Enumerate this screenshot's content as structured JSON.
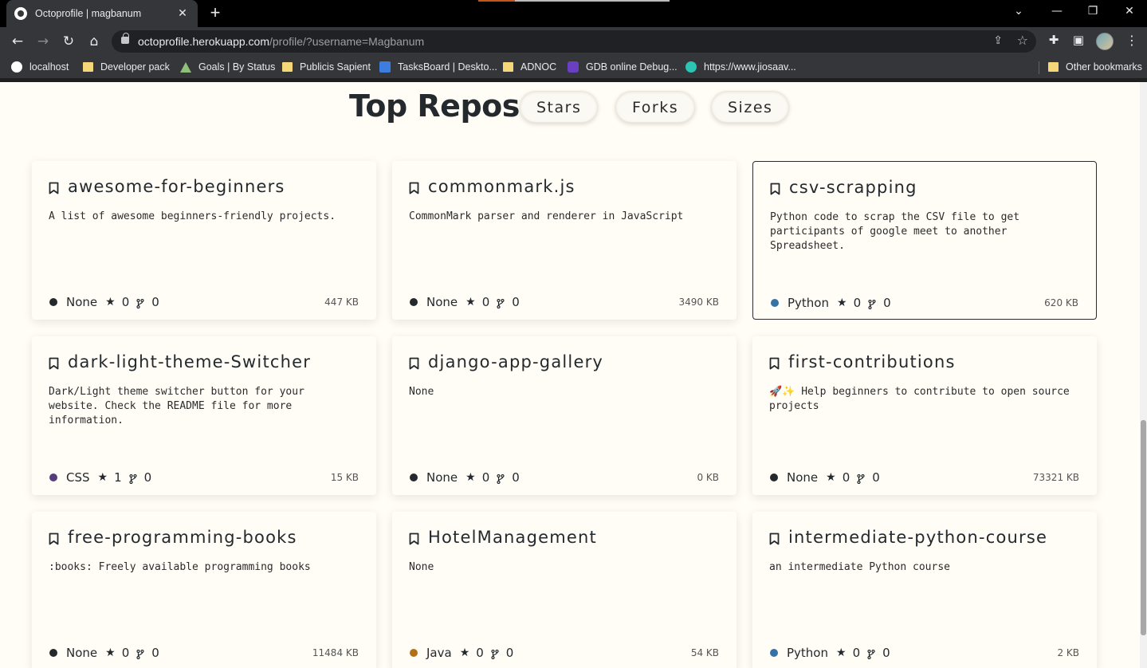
{
  "browser": {
    "tab_title": "Octoprofile | magbanum",
    "tab_close": "✕",
    "new_tab": "+",
    "url_host": "octoprofile.herokuapp.com",
    "url_path": "/profile/?username=Magbanum",
    "bookmarks": [
      {
        "label": "localhost",
        "icon": "github-icon"
      },
      {
        "label": "Developer pack",
        "icon": "folder-icon"
      },
      {
        "label": "Goals | By Status",
        "icon": "triangle-icon"
      },
      {
        "label": "Publicis Sapient",
        "icon": "folder-icon"
      },
      {
        "label": "TasksBoard | Deskto...",
        "icon": "tasksboard-icon"
      },
      {
        "label": "ADNOC",
        "icon": "folder-icon"
      },
      {
        "label": "GDB online Debug...",
        "icon": "gdb-icon"
      },
      {
        "label": "https://www.jiosaav...",
        "icon": "jiosaavn-icon"
      }
    ],
    "other_bookmarks": "Other bookmarks"
  },
  "page": {
    "heading": "Top Repos",
    "sort_buttons": [
      "Stars",
      "Forks",
      "Sizes"
    ]
  },
  "repos": [
    {
      "name": "awesome-for-beginners",
      "description": "A list of awesome beginners-friendly projects.",
      "language": "None",
      "lang_color": "#24292e",
      "stars": "0",
      "forks": "0",
      "size": "447 KB"
    },
    {
      "name": "commonmark.js",
      "description": "CommonMark parser and renderer in JavaScript",
      "language": "None",
      "lang_color": "#24292e",
      "stars": "0",
      "forks": "0",
      "size": "3490 KB"
    },
    {
      "name": "csv-scrapping",
      "description": "Python code to scrap the CSV file to get participants of google meet to another Spreadsheet.",
      "language": "Python",
      "lang_color": "#3572a5",
      "stars": "0",
      "forks": "0",
      "size": "620 KB"
    },
    {
      "name": "dark-light-theme-Switcher",
      "description": "Dark/Light theme switcher button for your website. Check the README file for more information.",
      "language": "CSS",
      "lang_color": "#563d7c",
      "stars": "1",
      "forks": "0",
      "size": "15 KB"
    },
    {
      "name": "django-app-gallery",
      "description": "None",
      "language": "None",
      "lang_color": "#24292e",
      "stars": "0",
      "forks": "0",
      "size": "0 KB"
    },
    {
      "name": "first-contributions",
      "description": "🚀✨ Help beginners to contribute to open source projects",
      "language": "None",
      "lang_color": "#24292e",
      "stars": "0",
      "forks": "0",
      "size": "73321 KB"
    },
    {
      "name": "free-programming-books",
      "description": ":books: Freely available programming books",
      "language": "None",
      "lang_color": "#24292e",
      "stars": "0",
      "forks": "0",
      "size": "11484 KB"
    },
    {
      "name": "HotelManagement",
      "description": "None",
      "language": "Java",
      "lang_color": "#b07219",
      "stars": "0",
      "forks": "0",
      "size": "54 KB"
    },
    {
      "name": "intermediate-python-course",
      "description": "an intermediate Python course",
      "language": "Python",
      "lang_color": "#3572a5",
      "stars": "0",
      "forks": "0",
      "size": "2 KB"
    }
  ]
}
